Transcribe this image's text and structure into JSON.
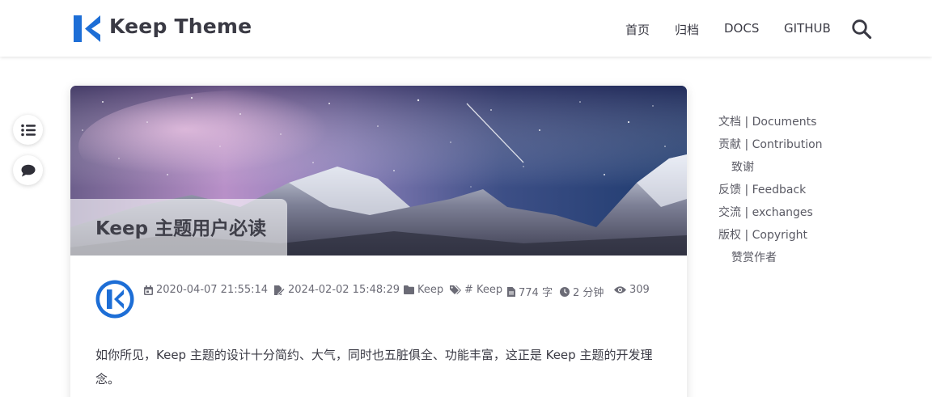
{
  "header": {
    "site_title": "Keep Theme",
    "nav": [
      {
        "label": "首页"
      },
      {
        "label": "归档"
      },
      {
        "label": "DOCS"
      },
      {
        "label": "GITHUB"
      }
    ]
  },
  "colors": {
    "brand_blue": "#1d6ed6",
    "text_dark": "#3a3a44",
    "text_muted": "#6b6b76"
  },
  "post": {
    "title": "Keep 主题用户必读",
    "meta": {
      "created": "2020-04-07 21:55:14",
      "updated": "2024-02-02 15:48:29",
      "category": "Keep",
      "tag": "# Keep",
      "word_count": "774 字",
      "read_time": "2 分钟",
      "views": "309"
    },
    "paragraph": "如你所见，Keep 主题的设计十分简约、大气，同时也五脏俱全、功能丰富，这正是 Keep 主题的开发理念。"
  },
  "toc": {
    "items": [
      {
        "label": "文档 | Documents",
        "level": 1
      },
      {
        "label": "贡献 | Contribution",
        "level": 1
      },
      {
        "label": "致谢",
        "level": 2
      },
      {
        "label": "反馈 | Feedback",
        "level": 1
      },
      {
        "label": "交流 | exchanges",
        "level": 1
      },
      {
        "label": "版权 | Copyright",
        "level": 1
      },
      {
        "label": "赞赏作者",
        "level": 2
      }
    ]
  },
  "icons": {
    "search": "search-icon",
    "toc_toggle": "list-icon",
    "comment": "comment-icon"
  }
}
